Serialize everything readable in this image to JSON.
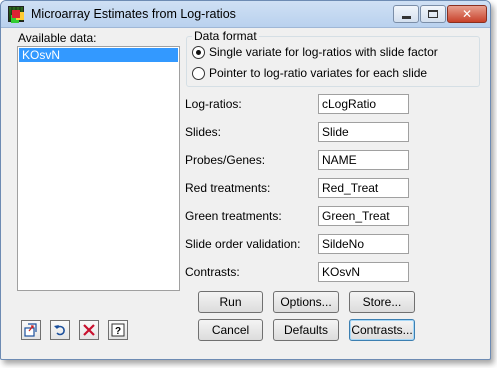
{
  "window": {
    "title": "Microarray Estimates from Log-ratios"
  },
  "available_data": {
    "label": "Available data:",
    "items": [
      "KOsvN"
    ]
  },
  "data_format": {
    "title": "Data format",
    "options": [
      {
        "label": "Single variate for log-ratios with slide factor",
        "selected": true
      },
      {
        "label": "Pointer to log-ratio variates for each slide",
        "selected": false
      }
    ]
  },
  "fields": [
    {
      "label": "Log-ratios:",
      "value": "cLogRatio"
    },
    {
      "label": "Slides:",
      "value": "Slide"
    },
    {
      "label": "Probes/Genes:",
      "value": "NAME"
    },
    {
      "label": "Red treatments:",
      "value": "Red_Treat"
    },
    {
      "label": "Green treatments:",
      "value": "Green_Treat"
    },
    {
      "label": "Slide order validation:",
      "value": "SildeNo"
    },
    {
      "label": "Contrasts:",
      "value": "KOsvN"
    }
  ],
  "buttons": {
    "run": "Run",
    "options": "Options...",
    "store": "Store...",
    "cancel": "Cancel",
    "defaults": "Defaults",
    "contrasts": "Contrasts..."
  },
  "toolbar_icons": [
    "copy-to-icon",
    "undo-icon",
    "clear-icon",
    "help-icon"
  ]
}
